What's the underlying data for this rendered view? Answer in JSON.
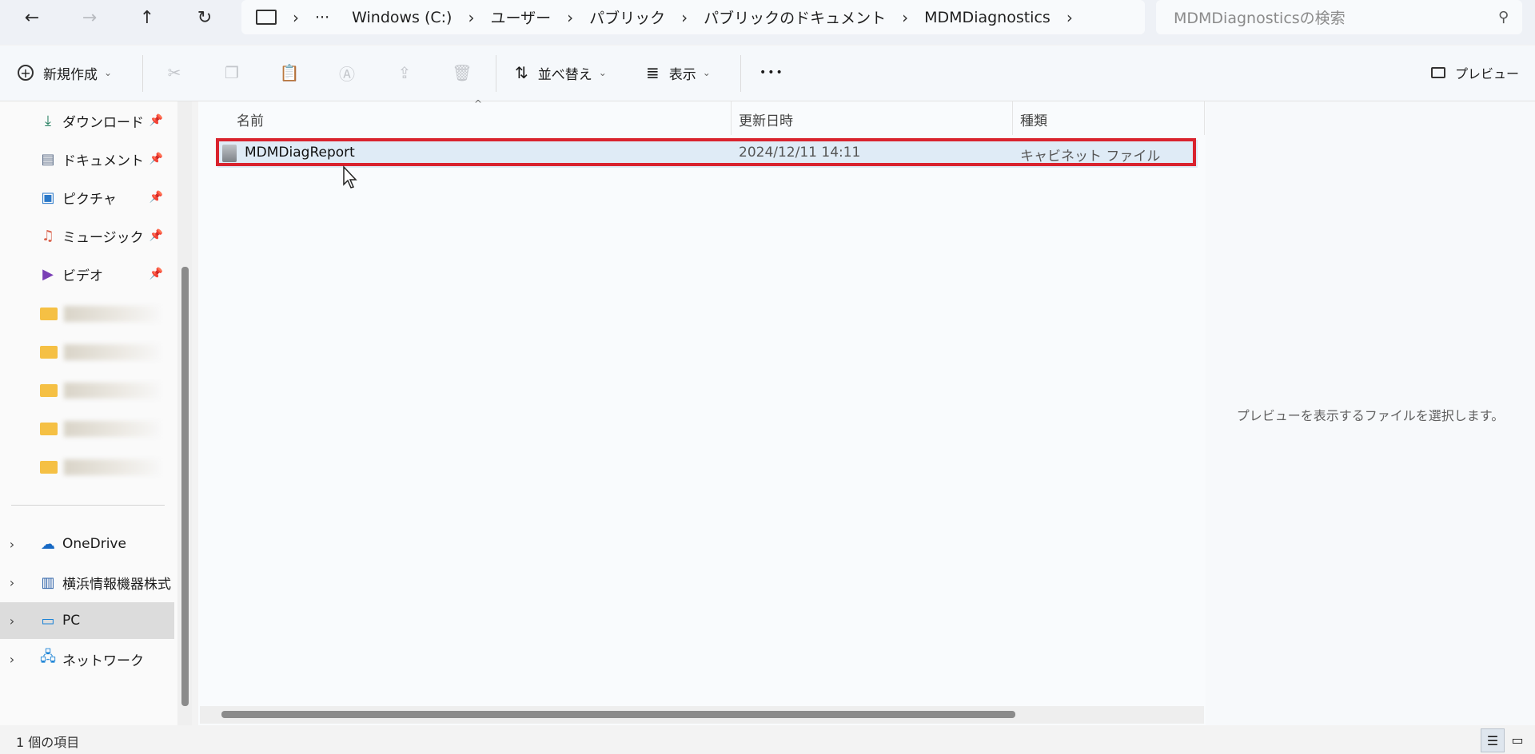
{
  "address": {
    "crumbs": [
      "Windows (C:)",
      "ユーザー",
      "パブリック",
      "パブリックのドキュメント",
      "MDMDiagnostics"
    ],
    "overflow": "···"
  },
  "search": {
    "placeholder": "MDMDiagnosticsの検索"
  },
  "toolbar": {
    "new_label": "新規作成",
    "sort_label": "並べ替え",
    "view_label": "表示",
    "more_label": "•••",
    "preview_label": "プレビュー"
  },
  "nav": {
    "quick": [
      {
        "label": "ダウンロード",
        "icon": "download-icon"
      },
      {
        "label": "ドキュメント",
        "icon": "document-icon"
      },
      {
        "label": "ピクチャ",
        "icon": "pictures-icon"
      },
      {
        "label": "ミュージック",
        "icon": "music-icon"
      },
      {
        "label": "ビデオ",
        "icon": "video-icon"
      }
    ],
    "tree": [
      {
        "label": "OneDrive",
        "icon": "onedrive-icon"
      },
      {
        "label": "横浜情報機器株式",
        "icon": "building-icon"
      },
      {
        "label": "PC",
        "icon": "pc-icon"
      },
      {
        "label": "ネットワーク",
        "icon": "network-icon"
      }
    ]
  },
  "list": {
    "columns": [
      "名前",
      "更新日時",
      "種類"
    ],
    "rows": [
      {
        "name": "MDMDiagReport",
        "modified": "2024/12/11 14:11",
        "type": "キャビネット ファイル"
      }
    ]
  },
  "preview": {
    "message": "プレビューを表示するファイルを選択します。"
  },
  "status": {
    "count": "1 個の項目"
  },
  "colors": {
    "accent": "#0067c0",
    "highlight_border": "#d9232e",
    "selected_row": "#dfebf6"
  }
}
